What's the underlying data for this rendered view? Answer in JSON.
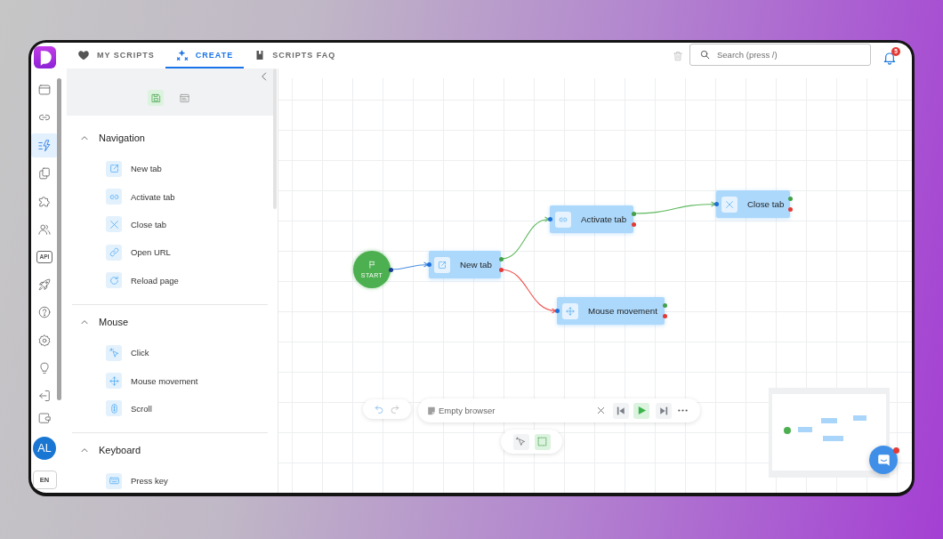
{
  "app_tabs": [
    {
      "label": "MY SCRIPTS",
      "selected": false
    },
    {
      "label": "CREATE",
      "selected": true
    },
    {
      "label": "SCRIPTS FAQ",
      "selected": false
    }
  ],
  "search": {
    "placeholder": "Search (press /)"
  },
  "notifications": {
    "count": "5"
  },
  "rail": {
    "items": [
      {
        "selected": false
      },
      {
        "selected": false
      },
      {
        "selected": true
      },
      {
        "selected": false
      },
      {
        "selected": false
      },
      {
        "selected": false
      },
      {
        "label": "API",
        "selected": false
      },
      {
        "selected": false
      },
      {
        "selected": false
      },
      {
        "selected": false
      },
      {
        "selected": false
      },
      {
        "selected": false
      },
      {
        "selected": false
      }
    ],
    "avatar": "AL",
    "language": "EN"
  },
  "panel": {
    "views": [
      {
        "selected": true
      },
      {
        "selected": false
      }
    ],
    "sections": [
      {
        "title": "Navigation",
        "expanded": true,
        "items": [
          "New tab",
          "Activate tab",
          "Close tab",
          "Open URL",
          "Reload page"
        ]
      },
      {
        "title": "Mouse",
        "expanded": true,
        "items": [
          "Click",
          "Mouse movement",
          "Scroll"
        ]
      },
      {
        "title": "Keyboard",
        "expanded": true,
        "items": [
          "Press key"
        ]
      }
    ]
  },
  "canvas": {
    "nodes": [
      {
        "kind": "start",
        "label": "START"
      },
      {
        "kind": "action",
        "label": "New tab"
      },
      {
        "kind": "action",
        "label": "Activate tab"
      },
      {
        "kind": "action",
        "label": "Close tab"
      },
      {
        "kind": "action",
        "label": "Mouse movement"
      }
    ],
    "edges": [
      {
        "kind": "start"
      },
      {
        "kind": "success"
      },
      {
        "kind": "failure"
      },
      {
        "kind": "success"
      }
    ]
  },
  "history": [
    {
      "disabled": false
    },
    {
      "disabled": true
    }
  ],
  "player": {
    "browser": "Empty browser"
  },
  "tools": [
    {
      "selected": false
    },
    {
      "selected": true
    }
  ],
  "chat": {
    "unread": true
  }
}
